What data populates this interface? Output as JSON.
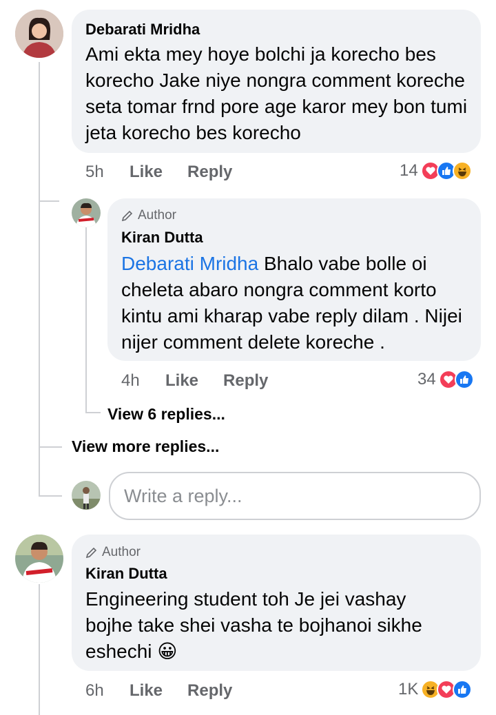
{
  "comment1": {
    "name": "Debarati Mridha",
    "text": "Ami ekta mey hoye bolchi ja korecho bes korecho Jake niye nongra comment koreche seta tomar frnd pore age karor mey bon tumi jeta korecho bes korecho",
    "time": "5h",
    "like": "Like",
    "reply": "Reply",
    "reaction_count": "14",
    "reactions": [
      "love-icon",
      "like-icon",
      "haha-icon"
    ]
  },
  "reply1": {
    "badge": "Author",
    "name": "Kiran Dutta",
    "mention": "Debarati Mridha",
    "text": " Bhalo vabe bolle oi cheleta abaro nongra comment korto kintu ami kharap vabe reply dilam . Nijei nijer comment delete koreche .",
    "time": "4h",
    "like": "Like",
    "reply": "Reply",
    "reaction_count": "34",
    "reactions": [
      "love-icon",
      "like-icon"
    ]
  },
  "view_replies": "View 6 replies...",
  "view_more": "View more replies...",
  "reply_input": {
    "placeholder": "Write a reply..."
  },
  "comment2": {
    "badge": "Author",
    "name": "Kiran Dutta",
    "text": "Engineering student toh Je jei vashay bojhe take shei vasha te bojhanoi sikhe eshechi",
    "emoji": "😀",
    "time": "6h",
    "like": "Like",
    "reply": "Reply",
    "reaction_count": "1K",
    "reactions": [
      "haha-icon",
      "love-icon",
      "like-icon"
    ]
  },
  "colors": {
    "bubble": "#f0f2f5",
    "link": "#1b74e4",
    "love": "#f33e58",
    "like": "#1877f2",
    "haha": "#f7b125"
  }
}
